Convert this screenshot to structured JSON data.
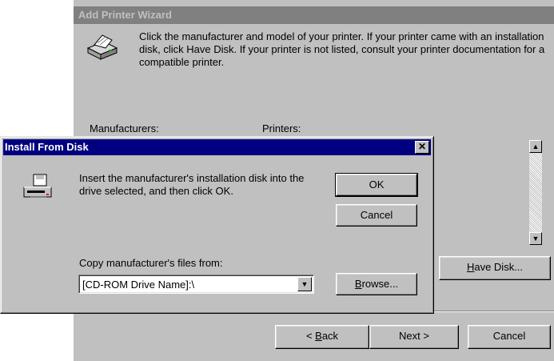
{
  "wizard": {
    "title": "Add Printer Wizard",
    "description": "Click the manufacturer and model of your printer. If your printer came with an installation disk, click Have Disk. If your printer is not listed, consult your printer documentation for a compatible printer.",
    "manufacturers_label": "Manufacturers:",
    "printers_label": "Printers:",
    "have_disk_prefix": "H",
    "have_disk_rest": "ave Disk...",
    "back_lt": "< ",
    "back_u": "B",
    "back_rest": "ack",
    "next_label": "Next >",
    "cancel_label": "Cancel",
    "scroll_up": "▲",
    "scroll_down": "▼"
  },
  "disk_dialog": {
    "title": "Install From Disk",
    "close_glyph": "✕",
    "message": "Insert the manufacturer's installation disk into the drive selected, and then click OK.",
    "ok_label": "OK",
    "cancel_label": "Cancel",
    "copy_label": "Copy manufacturer's files from:",
    "path_value": "[CD-ROM Drive Name]:\\",
    "dropdown_glyph": "▼",
    "browse_u": "B",
    "browse_rest": "rowse..."
  },
  "icons": {
    "printer": "printer-icon",
    "disk_drive": "disk-drive-icon"
  }
}
